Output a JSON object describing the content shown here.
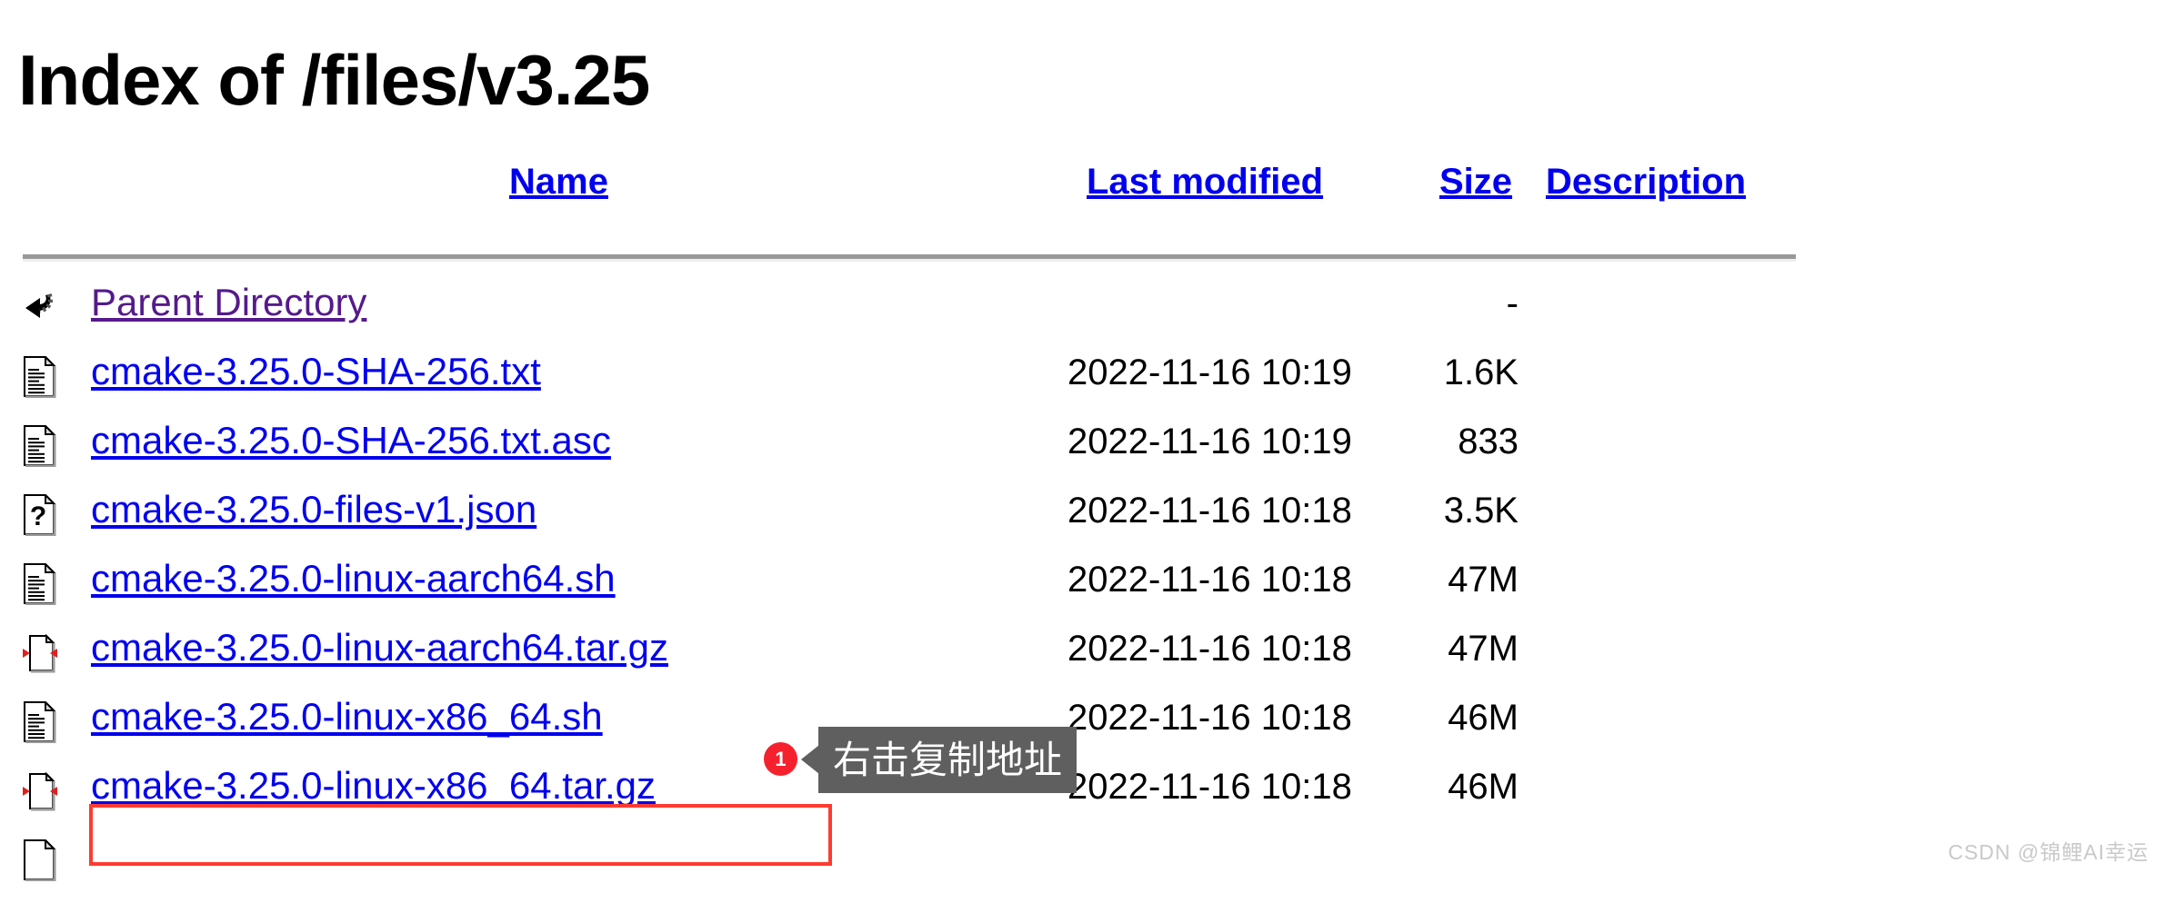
{
  "page": {
    "title": "Index of /files/v3.25"
  },
  "table": {
    "headers": {
      "name": "Name",
      "last_modified": "Last modified",
      "size": "Size",
      "description": "Description"
    },
    "rows": [
      {
        "icon": "back-arrow-icon",
        "name": "Parent Directory",
        "visited": true,
        "last_modified": "",
        "size": "-"
      },
      {
        "icon": "text-document-icon",
        "name": "cmake-3.25.0-SHA-256.txt",
        "visited": false,
        "last_modified": "2022-11-16 10:19",
        "size": "1.6K"
      },
      {
        "icon": "text-document-icon",
        "name": "cmake-3.25.0-SHA-256.txt.asc",
        "visited": false,
        "last_modified": "2022-11-16 10:19",
        "size": "833"
      },
      {
        "icon": "unknown-document-icon",
        "name": "cmake-3.25.0-files-v1.json",
        "visited": false,
        "last_modified": "2022-11-16 10:18",
        "size": "3.5K"
      },
      {
        "icon": "text-document-icon",
        "name": "cmake-3.25.0-linux-aarch64.sh",
        "visited": false,
        "last_modified": "2022-11-16 10:18",
        "size": "47M"
      },
      {
        "icon": "compressed-archive-icon",
        "name": "cmake-3.25.0-linux-aarch64.tar.gz",
        "visited": false,
        "last_modified": "2022-11-16 10:18",
        "size": "47M"
      },
      {
        "icon": "text-document-icon",
        "name": "cmake-3.25.0-linux-x86_64.sh",
        "visited": false,
        "last_modified": "2022-11-16 10:18",
        "size": "46M"
      },
      {
        "icon": "compressed-archive-icon",
        "name": "cmake-3.25.0-linux-x86_64.tar.gz",
        "visited": false,
        "last_modified": "2022-11-16 10:18",
        "size": "46M"
      },
      {
        "icon": "blank-document-icon",
        "name": "",
        "visited": false,
        "last_modified": "",
        "size": ""
      }
    ]
  },
  "annotations": {
    "step_badge": "1",
    "tooltip_text": "右击复制地址",
    "highlight_color": "#ff3b30",
    "badge_color": "#f5222d",
    "tooltip_bg": "#5f5f5f"
  },
  "watermark": {
    "text": "CSDN @锦鲤AI幸运"
  },
  "colors": {
    "link": "#0000ee",
    "visited_link": "#551a8b",
    "text": "#000000",
    "rule": "#999999"
  }
}
